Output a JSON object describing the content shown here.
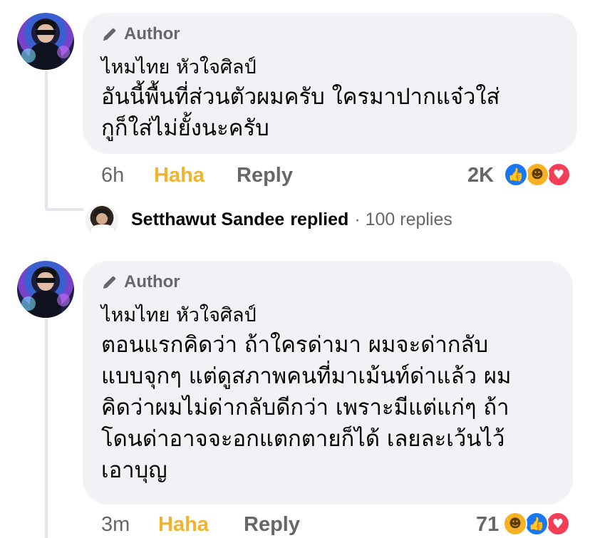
{
  "comments": [
    {
      "author_tag": "Author",
      "name": "ไหมไทย หัวใจศิลป์",
      "lines": [
        "อันนี้พื้นที่ส่วนตัวผมครับ ใครมาปากแจ๋วใส่",
        "กูก็ใส่ไม่ยั้งนะครับ"
      ],
      "time": "6h",
      "reaction_label": "Haha",
      "reply_label": "Reply",
      "reaction_count": "2K",
      "reactions": [
        "like",
        "haha",
        "love"
      ],
      "reply_summary": {
        "name": "Setthawut Sandee",
        "verb": "replied",
        "count": "· 100 replies"
      }
    },
    {
      "author_tag": "Author",
      "name": "ไหมไทย หัวใจศิลป์",
      "lines": [
        "ตอนแรกคิดว่า ถ้าใครด่ามา ผมจะด่ากลับ",
        "แบบจุกๆ แต่ดูสภาพคนที่มาเม้นท์ด่าแล้ว ผม",
        "คิดว่าผมไม่ด่ากลับดีกว่า เพราะมีแต่แก่ๆ ถ้า",
        "โดนด่าอาจจะอกแตกตายก็ได้ เลยละเว้นไว้",
        "เอาบุญ"
      ],
      "time": "3m",
      "reaction_label": "Haha",
      "reply_label": "Reply",
      "reaction_count": "71",
      "reactions": [
        "haha",
        "like",
        "love"
      ]
    }
  ],
  "colors": {
    "bubble": "#f0f2f5",
    "meta": "#65676b",
    "haha_active": "#f0b431",
    "like": "#1877f2",
    "love": "#f33e58",
    "haha": "#f7b125"
  }
}
